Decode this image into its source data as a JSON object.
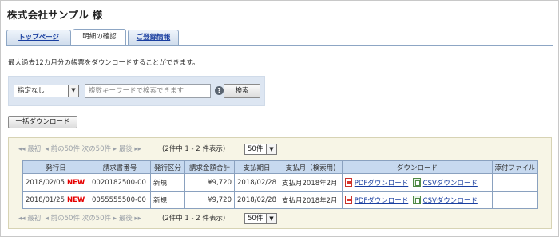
{
  "header": {
    "company": "株式会社サンプル 様"
  },
  "tabs": [
    {
      "label": "トップページ"
    },
    {
      "label": "明細の確認"
    },
    {
      "label": "ご登録情報"
    }
  ],
  "description": "最大過去12カ月分の帳票をダウンロードすることができます。",
  "search": {
    "filter_value": "指定なし",
    "keyword_placeholder": "複数キーワードで検索できます",
    "help_symbol": "?",
    "search_label": "検索"
  },
  "bulk_download_label": "一括ダウンロード",
  "pager": {
    "first": "最初",
    "prev": "前の50件",
    "next": "次の50件",
    "last": "最後",
    "count": "(2件中 1 - 2 件表示)",
    "per_page": "50件"
  },
  "table": {
    "columns": [
      "発行日",
      "請求書番号",
      "発行区分",
      "請求金額合計",
      "支払期日",
      "支払月（検索用)",
      "ダウンロード",
      "添付ファイル"
    ],
    "rows": [
      {
        "date": "2018/02/05",
        "badge": "NEW",
        "invoice": "0020182500-00",
        "type": "新規",
        "amount": "¥9,720",
        "due": "2018/02/28",
        "month": "支払月2018年2月",
        "pdf": "PDFダウンロード",
        "csv": "CSVダウンロード",
        "attachment": ""
      },
      {
        "date": "2018/01/25",
        "badge": "NEW",
        "invoice": "0055555500-00",
        "type": "新規",
        "amount": "¥9,720",
        "due": "2018/02/28",
        "month": "支払月2018年2月",
        "pdf": "PDFダウンロード",
        "csv": "CSVダウンロード",
        "attachment": ""
      }
    ]
  },
  "colors": {
    "tab_link": "#1a3fa0",
    "new_badge": "#e60000",
    "table_header": "#c7d9ef",
    "panel_bg": "#f7f5e6"
  }
}
